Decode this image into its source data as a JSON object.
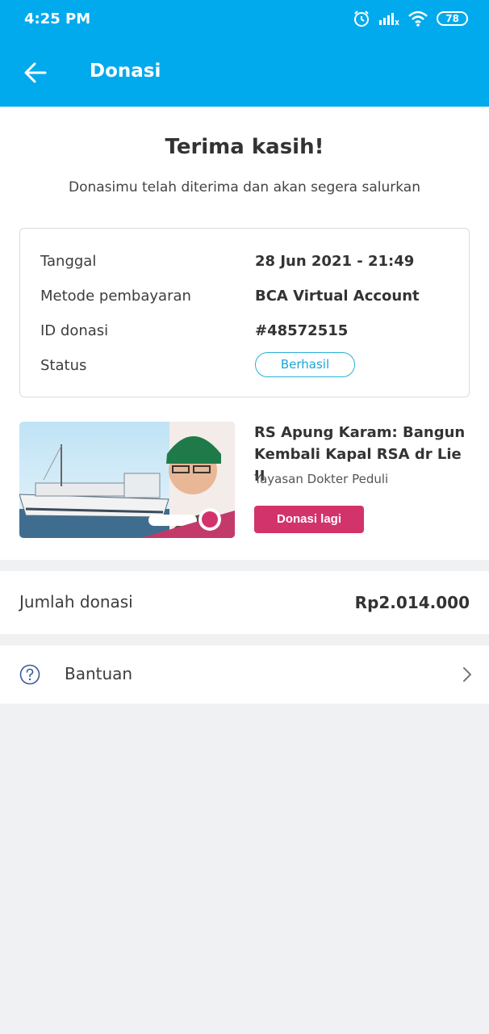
{
  "status_bar": {
    "time": "4:25 PM",
    "battery": "78",
    "icons": [
      "alarm-icon",
      "signal-icon",
      "wifi-icon",
      "battery-icon"
    ]
  },
  "app_bar": {
    "title": "Donasi",
    "back_icon": "arrow-left-icon"
  },
  "confirmation": {
    "heading": "Terima kasih!",
    "message": "Donasimu telah diterima dan akan segera salurkan"
  },
  "details": {
    "date_label": "Tanggal",
    "date_value": "28 Jun 2021 - 21:49",
    "method_label": "Metode pembayaran",
    "method_value": "BCA Virtual Account",
    "id_label": "ID donasi",
    "id_value": "#48572515",
    "status_label": "Status",
    "status_value": "Berhasil"
  },
  "campaign": {
    "title": "RS Apung Karam: Bangun Kembali Kapal RSA dr Lie II",
    "organizer": "Yayasan Dokter Peduli",
    "button_label": "Donasi lagi"
  },
  "amount": {
    "label": "Jumlah donasi",
    "value": "Rp2.014.000"
  },
  "help": {
    "label": "Bantuan"
  },
  "colors": {
    "primary": "#01aaec",
    "accent": "#d2336b",
    "status_border": "#27b1d9"
  }
}
